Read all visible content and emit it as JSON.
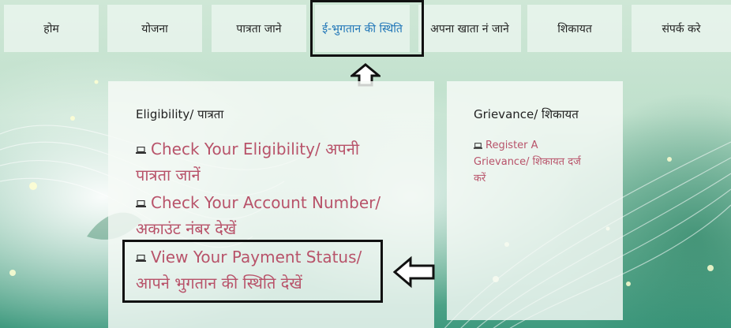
{
  "nav": {
    "items": [
      {
        "label": "होम"
      },
      {
        "label": "योजना"
      },
      {
        "label": "पात्रता जाने"
      },
      {
        "label": "ई-भुगतान की स्थिति"
      },
      {
        "label": "अपना खाता नं जाने"
      },
      {
        "label": "शिकायत"
      },
      {
        "label": "संपर्क करे"
      }
    ],
    "active_index": 3
  },
  "eligibility_panel": {
    "title": "Eligibility/ पात्रता",
    "links": [
      {
        "line1": "Check Your Eligibility/ अपनी",
        "line2": "पात्रता जानें"
      },
      {
        "line1": "Check Your Account Number/",
        "line2": "अकाउंट नंबर देखें"
      },
      {
        "line1": "View Your Payment Status/",
        "line2": "आपने भुगतान की स्थिति देखें"
      }
    ]
  },
  "grievance_panel": {
    "title": "Grievance/ शिकायत",
    "link": {
      "line1": "Register A",
      "line2": "Grievance/ शिकायत दर्ज",
      "line3": "करें"
    }
  },
  "icons": {
    "link_icon": "laptop-icon",
    "up_arrow": "arrow-up-icon",
    "left_arrow": "arrow-left-icon"
  },
  "colors": {
    "link": "#b8536a",
    "active_nav": "#1d74b7",
    "highlight": "#111111"
  }
}
